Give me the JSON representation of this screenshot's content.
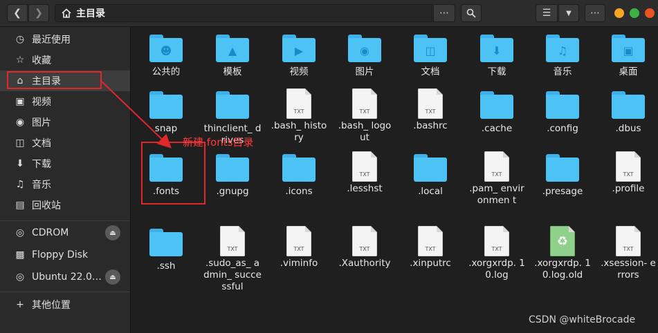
{
  "header": {
    "path_label": "主目录",
    "back_icon": "chevron-left-icon",
    "forward_icon": "chevron-right-icon",
    "home_icon": "home-icon",
    "search_icon": "search-icon",
    "menu_icon": "more-icon"
  },
  "sidebar": {
    "items": [
      {
        "label": "最近使用",
        "icon": "clock-icon"
      },
      {
        "label": "收藏",
        "icon": "star-icon"
      },
      {
        "label": "主目录",
        "icon": "home-icon"
      },
      {
        "label": "视频",
        "icon": "film-icon"
      },
      {
        "label": "图片",
        "icon": "camera-icon"
      },
      {
        "label": "文档",
        "icon": "document-icon"
      },
      {
        "label": "下载",
        "icon": "download-icon"
      },
      {
        "label": "音乐",
        "icon": "music-icon"
      },
      {
        "label": "回收站",
        "icon": "trash-icon"
      }
    ],
    "devices": [
      {
        "label": "CDROM",
        "icon": "disc-icon"
      },
      {
        "label": "Floppy Disk",
        "icon": "floppy-icon"
      },
      {
        "label": "Ubuntu 22.0…",
        "icon": "disc-icon"
      }
    ],
    "other_locations": "其他位置"
  },
  "files": [
    {
      "label": "公共的",
      "kind": "folder"
    },
    {
      "label": "模板",
      "kind": "folder"
    },
    {
      "label": "视频",
      "kind": "folder"
    },
    {
      "label": "图片",
      "kind": "folder"
    },
    {
      "label": "文档",
      "kind": "folder"
    },
    {
      "label": "下载",
      "kind": "folder"
    },
    {
      "label": "音乐",
      "kind": "folder"
    },
    {
      "label": "桌面",
      "kind": "folder"
    },
    {
      "label": "snap",
      "kind": "folder"
    },
    {
      "label": "thinclient_ drives",
      "kind": "folder"
    },
    {
      "label": ".bash_ history",
      "kind": "text"
    },
    {
      "label": ".bash_ logout",
      "kind": "text"
    },
    {
      "label": ".bashrc",
      "kind": "text"
    },
    {
      "label": ".cache",
      "kind": "folder"
    },
    {
      "label": ".config",
      "kind": "folder"
    },
    {
      "label": ".dbus",
      "kind": "folder"
    },
    {
      "label": ".fonts",
      "kind": "folder"
    },
    {
      "label": ".gnupg",
      "kind": "folder"
    },
    {
      "label": ".icons",
      "kind": "folder"
    },
    {
      "label": ".lesshst",
      "kind": "text"
    },
    {
      "label": ".local",
      "kind": "folder"
    },
    {
      "label": ".pam_ environmen t",
      "kind": "text"
    },
    {
      "label": ".presage",
      "kind": "folder"
    },
    {
      "label": ".profile",
      "kind": "text"
    },
    {
      "label": ".ssh",
      "kind": "folder"
    },
    {
      "label": ".sudo_as_ admin_ successful",
      "kind": "text"
    },
    {
      "label": ".viminfo",
      "kind": "text"
    },
    {
      "label": ".Xauthority",
      "kind": "text"
    },
    {
      "label": ".xinputrc",
      "kind": "text"
    },
    {
      "label": ".xorgxrdp. 10.log",
      "kind": "text"
    },
    {
      "label": ".xorgxrdp. 10.log.old",
      "kind": "recycle"
    },
    {
      "label": ".xsession- errors",
      "kind": "text"
    }
  ],
  "file_type_badge": "TXT",
  "annotation": {
    "text": "新建.fonts目录",
    "color": "#e0282a"
  },
  "watermark": "CSDN @whiteBrocade"
}
